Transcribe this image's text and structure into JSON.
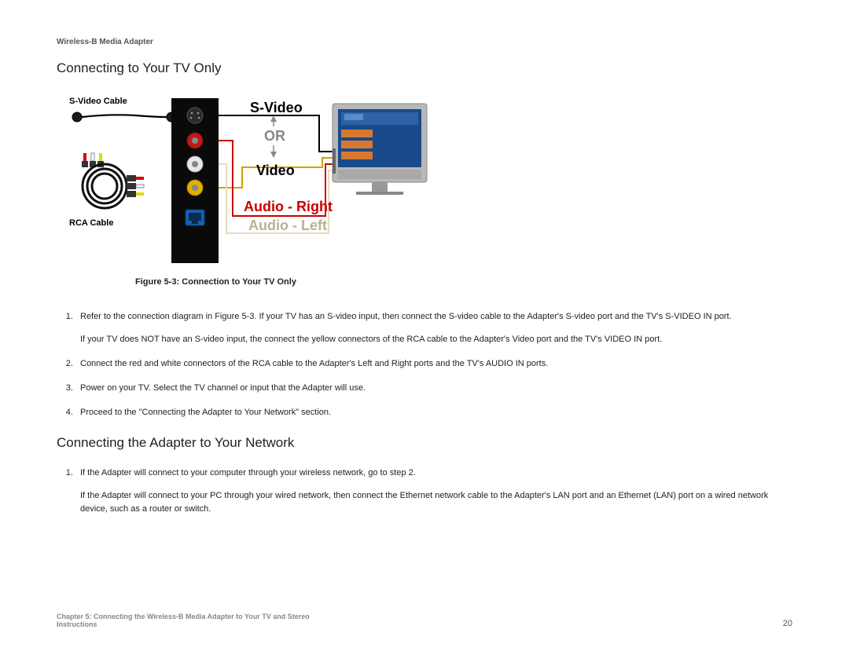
{
  "header": "Wireless-B Media Adapter",
  "section1_title": "Connecting to Your TV Only",
  "figure": {
    "caption": "Figure 5-3: Connection to Your TV Only",
    "labels": {
      "svideo_cable": "S-Video Cable",
      "rca_cable": "RCA Cable",
      "svideo": "S-Video",
      "or": "OR",
      "video": "Video",
      "audio_right": "Audio - Right",
      "audio_left": "Audio - Left"
    }
  },
  "list1": {
    "i1a": "Refer to the connection diagram in Figure 5-3. If your TV has an S-video input, then connect the S-video cable to the Adapter's S-video port and the TV's S-VIDEO IN port.",
    "i1b": "If your TV does NOT have an S-video input, the connect the yellow connectors of the RCA cable to the Adapter's Video port and the TV's VIDEO IN port.",
    "i2": "Connect the red and white connectors of the RCA cable to the Adapter's Left and Right ports and the TV's AUDIO IN ports.",
    "i3": "Power on your TV. Select the TV channel or input that the Adapter will use.",
    "i4": "Proceed to the \"Connecting the Adapter to Your Network\" section."
  },
  "section2_title": "Connecting the Adapter to Your Network",
  "list2": {
    "i1a": "If the Adapter will connect to your computer through your wireless network, go to step 2.",
    "i1b": "If the Adapter will connect to your PC through your wired network, then connect the Ethernet network cable to the Adapter's LAN port and an Ethernet (LAN) port on a wired network device, such as a router or switch."
  },
  "footer": {
    "chapter": "Chapter 5: Connecting the Wireless-B Media Adapter to Your TV and Stereo",
    "sub": "Instructions",
    "page": "20"
  }
}
